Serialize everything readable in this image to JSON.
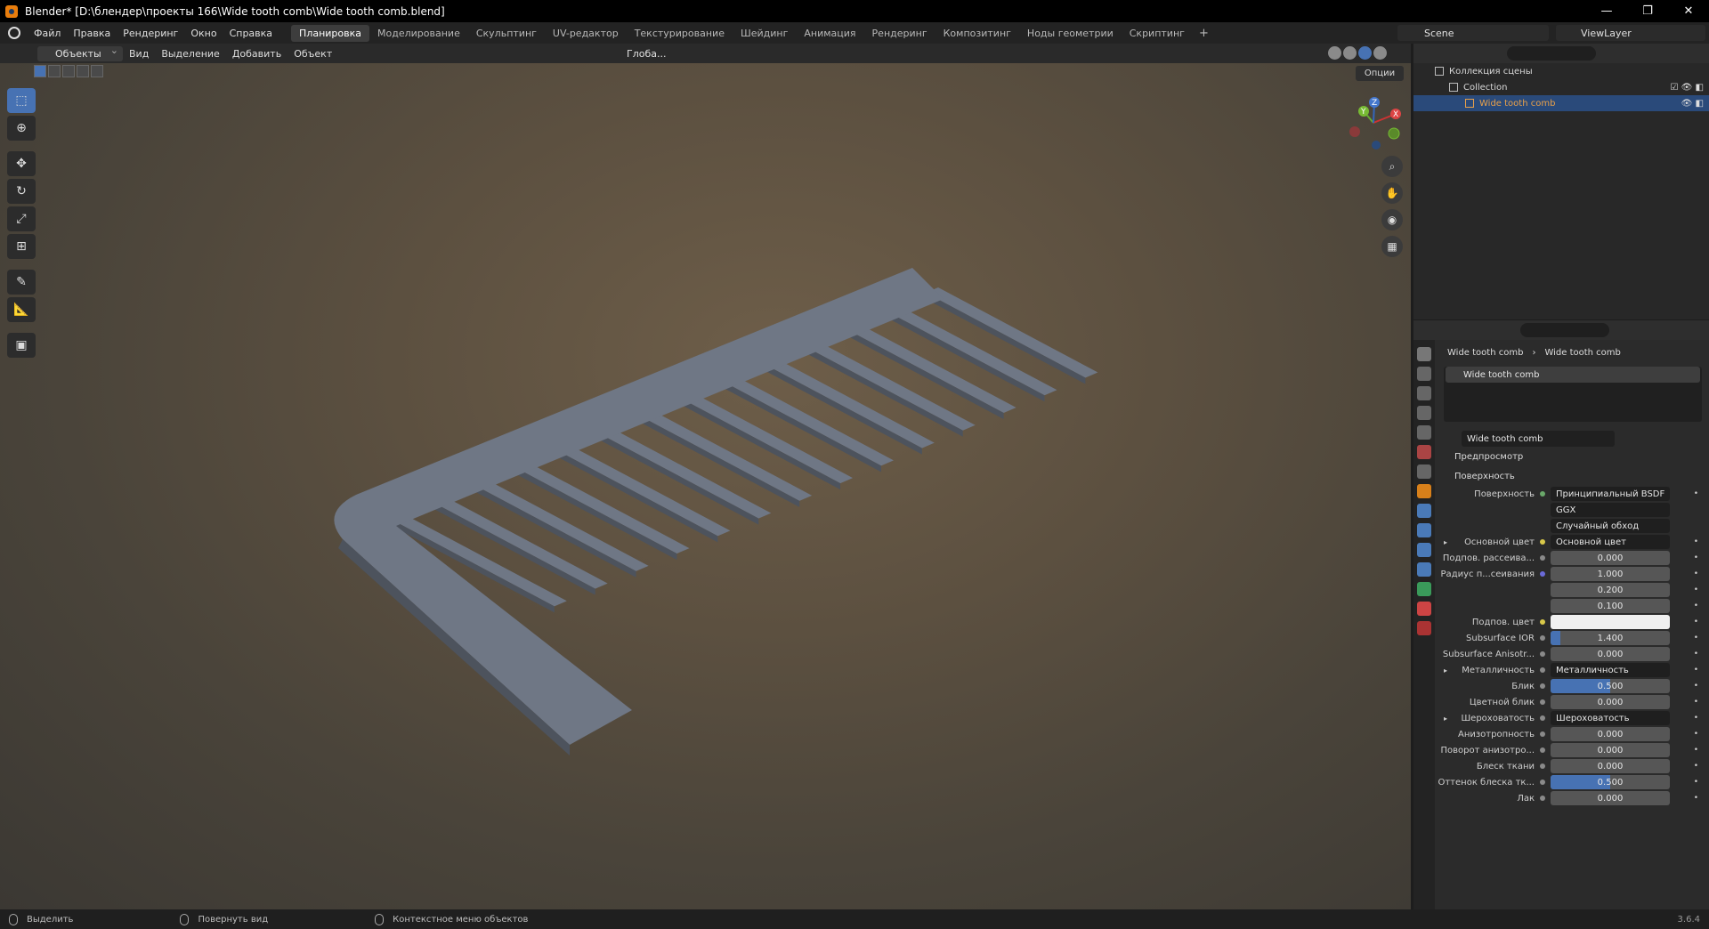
{
  "window": {
    "title": "Blender* [D:\\блендер\\проекты 166\\Wide tooth comb\\Wide tooth comb.blend]",
    "controls": [
      "—",
      "❐",
      "✕"
    ]
  },
  "menu": {
    "items": [
      "Файл",
      "Правка",
      "Рендеринг",
      "Окно",
      "Справка"
    ],
    "workspace_tabs": [
      "Планировка",
      "Моделирование",
      "Скульптинг",
      "UV-редактор",
      "Текстурирование",
      "Шейдинг",
      "Анимация",
      "Рендеринг",
      "Композитинг",
      "Ноды геометрии",
      "Скриптинг"
    ],
    "active_tab": "Планировка",
    "add_tab": "+",
    "scene": "Scene",
    "view_layer": "ViewLayer"
  },
  "viewport_header": {
    "mode": "Объекты",
    "items": [
      "Вид",
      "Выделение",
      "Добавить",
      "Объект"
    ],
    "transform": "Глоба...",
    "options": "Опции"
  },
  "gizmo": {
    "x": "X",
    "y": "Y",
    "z": "Z"
  },
  "outliner": {
    "rows": [
      {
        "label": "Коллекция сцены"
      },
      {
        "label": "Collection"
      },
      {
        "label": "Wide tooth comb"
      }
    ]
  },
  "properties": {
    "breadcrumb": [
      "Wide tooth comb",
      "Wide tooth comb"
    ],
    "slot": "Wide tooth comb",
    "material_name": "Wide tooth comb",
    "sections": {
      "preview": "Предпросмотр",
      "surface": "Поверхность"
    },
    "rows": [
      {
        "label": "Поверхность",
        "value": "Принципиальный BSDF",
        "kind": "link",
        "dot": "green"
      },
      {
        "label": "",
        "value": "GGX",
        "kind": "dropdown"
      },
      {
        "label": "",
        "value": "Случайный обход",
        "kind": "dropdown"
      },
      {
        "label": "Основной цвет",
        "value": "Основной цвет",
        "kind": "link",
        "dot": "yellow",
        "expand": true
      },
      {
        "label": "Подпов. рассеива...",
        "value": "0.000",
        "kind": "number",
        "dot": "grey"
      },
      {
        "label": "Радиус п...сеивания",
        "value": "1.000",
        "kind": "number",
        "dot": "blue"
      },
      {
        "label": "",
        "value": "0.200",
        "kind": "number"
      },
      {
        "label": "",
        "value": "0.100",
        "kind": "number"
      },
      {
        "label": "Подпов. цвет",
        "value": "",
        "kind": "color",
        "dot": "yellow"
      },
      {
        "label": "Subsurface IOR",
        "value": "1.400",
        "kind": "number",
        "dot": "grey",
        "fill": 0.08
      },
      {
        "label": "Subsurface Anisotr...",
        "value": "0.000",
        "kind": "number",
        "dot": "grey"
      },
      {
        "label": "Металличность",
        "value": "Металличность",
        "kind": "link",
        "dot": "grey",
        "expand": true
      },
      {
        "label": "Блик",
        "value": "0.500",
        "kind": "number",
        "dot": "grey",
        "fill": 0.5
      },
      {
        "label": "Цветной блик",
        "value": "0.000",
        "kind": "number",
        "dot": "grey"
      },
      {
        "label": "Шероховатость",
        "value": "Шероховатость",
        "kind": "link",
        "dot": "grey",
        "expand": true
      },
      {
        "label": "Анизотропность",
        "value": "0.000",
        "kind": "number",
        "dot": "grey"
      },
      {
        "label": "Поворот анизотро...",
        "value": "0.000",
        "kind": "number",
        "dot": "grey"
      },
      {
        "label": "Блеск ткани",
        "value": "0.000",
        "kind": "number",
        "dot": "grey"
      },
      {
        "label": "Оттенок блеска тк...",
        "value": "0.500",
        "kind": "number",
        "dot": "grey",
        "fill": 0.5
      },
      {
        "label": "Лак",
        "value": "0.000",
        "kind": "number",
        "dot": "grey"
      }
    ]
  },
  "statusbar": {
    "items": [
      "Выделить",
      "Повернуть вид",
      "Контекстное меню объектов"
    ],
    "version": "3.6.4"
  }
}
